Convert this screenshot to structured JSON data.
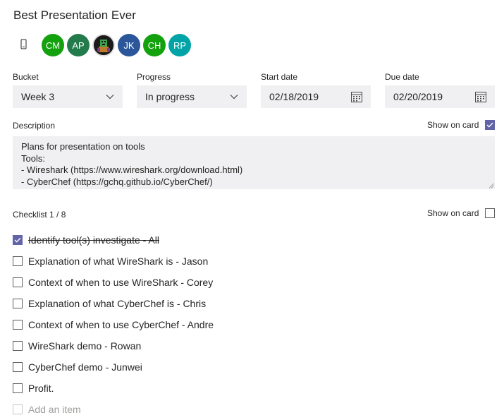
{
  "task": {
    "title": "Best Presentation Ever"
  },
  "assignees": [
    {
      "initials": "CM",
      "color": "#13a10e"
    },
    {
      "initials": "AP",
      "color": "#237b4b"
    },
    {
      "initials": "",
      "color": "#1b1b1b",
      "is_photo": true
    },
    {
      "initials": "JK",
      "color": "#2b579a"
    },
    {
      "initials": "CH",
      "color": "#13a10e"
    },
    {
      "initials": "RP",
      "color": "#00a4a6"
    }
  ],
  "fields": {
    "bucket": {
      "label": "Bucket",
      "value": "Week 3"
    },
    "progress": {
      "label": "Progress",
      "value": "In progress"
    },
    "start_date": {
      "label": "Start date",
      "value": "02/18/2019"
    },
    "due_date": {
      "label": "Due date",
      "value": "02/20/2019"
    }
  },
  "description": {
    "label": "Description",
    "show_on_card_label": "Show on card",
    "show_on_card": true,
    "lines": [
      "Plans for presentation on tools",
      "Tools:",
      "- Wireshark (https://www.wireshark.org/download.html)",
      "- CyberChef (https://gchq.github.io/CyberChef/)"
    ]
  },
  "checklist": {
    "label": "Checklist 1 / 8",
    "show_on_card_label": "Show on card",
    "show_on_card": false,
    "items": [
      {
        "text": "Identify tool(s) investigate - All",
        "checked": true
      },
      {
        "text": "Explanation of what WireShark is - Jason",
        "checked": false
      },
      {
        "text": "Context of when to use WireShark - Corey",
        "checked": false
      },
      {
        "text": "Explanation of what CyberChef is - Chris",
        "checked": false
      },
      {
        "text": "Context of when to use CyberChef - Andre",
        "checked": false
      },
      {
        "text": "WireShark demo - Rowan",
        "checked": false
      },
      {
        "text": "CyberChef demo - Junwei",
        "checked": false
      },
      {
        "text": "Profit.",
        "checked": false
      }
    ],
    "add_placeholder": "Add an item"
  },
  "colors": {
    "accent": "#6264a7",
    "field_bg": "#f0f0f2"
  }
}
